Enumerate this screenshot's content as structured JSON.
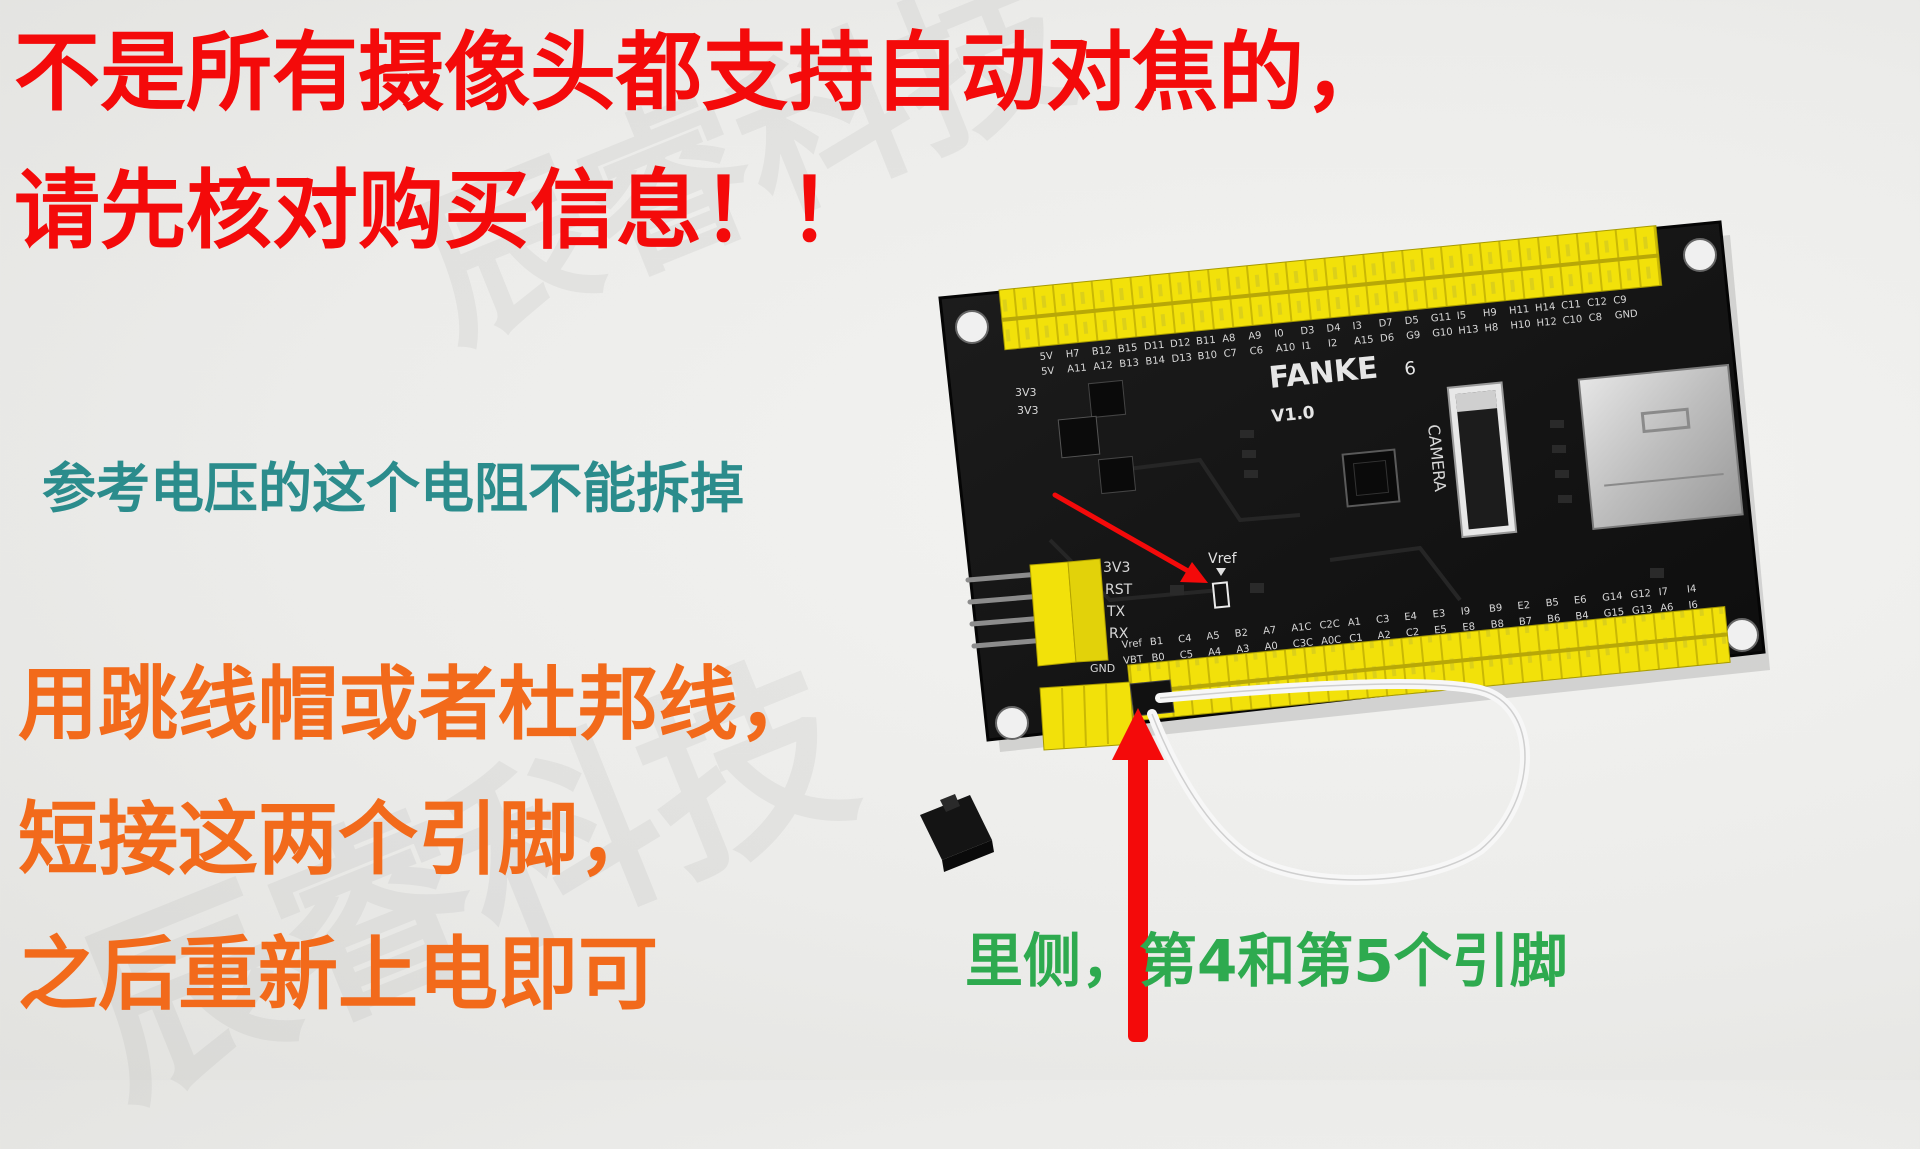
{
  "watermark": "辰睿科技",
  "headline": {
    "line1": "不是所有摄像头都支持自动对焦的，",
    "line2": "请先核对购买信息！！",
    "color": "#f40a0a"
  },
  "vref_note": {
    "text": "参考电压的这个电阻不能拆掉",
    "color": "#2b8c8c"
  },
  "jumper_note": {
    "line1": "用跳线帽或者杜邦线，",
    "line2": "短接这两个引脚，",
    "line3": "之后重新上电即可",
    "color": "#f26a1b"
  },
  "pin_note": {
    "text": "里侧，第4和第5个引脚",
    "color": "#2eaa4f"
  },
  "board": {
    "brand": "FANKE",
    "brand_suffix": "6",
    "version": "V1.0",
    "camera_label": "CAMERA",
    "vref_label": "Vref",
    "top_row_outer": [
      "5V",
      "H7",
      "B12",
      "B15",
      "D11",
      "D12",
      "B11",
      "A8",
      "A9",
      "I0",
      "D3",
      "D4",
      "I3",
      "D7",
      "D5",
      "G11",
      "I5",
      "H9",
      "H11",
      "H14",
      "C11",
      "C12",
      "C9"
    ],
    "top_row_inner": [
      "5V",
      "A11",
      "A12",
      "B13",
      "B14",
      "D13",
      "B10",
      "C7",
      "C6",
      "A10",
      "I1",
      "I2",
      "A15",
      "D6",
      "G9",
      "G10",
      "H13",
      "H8",
      "H10",
      "H12",
      "C10",
      "C8",
      "GND"
    ],
    "left_power": [
      "3V3",
      "3V3"
    ],
    "uart_labels": [
      "3V3",
      "RST",
      "TX",
      "RX"
    ],
    "bottom_row_inner": [
      "Vref",
      "B1",
      "C4",
      "A5",
      "B2",
      "A7",
      "A1C",
      "C2C",
      "A1",
      "C3",
      "E4",
      "E3",
      "I9",
      "B9",
      "E2",
      "B5",
      "E6",
      "G14",
      "G12",
      "I7",
      "I4"
    ],
    "bottom_row_outer": [
      "VBT",
      "B0",
      "C5",
      "A4",
      "A3",
      "A0",
      "C3C",
      "A0C",
      "C1",
      "A2",
      "C2",
      "E5",
      "E8",
      "B8",
      "B7",
      "B6",
      "B4",
      "G15",
      "G13",
      "A6",
      "I6"
    ],
    "bottom_gnd": "GND",
    "colors": {
      "pcb": "#151515",
      "header": "#f2e10a",
      "silk": "#d8d8d8",
      "arrow": "#f40a0a"
    }
  }
}
